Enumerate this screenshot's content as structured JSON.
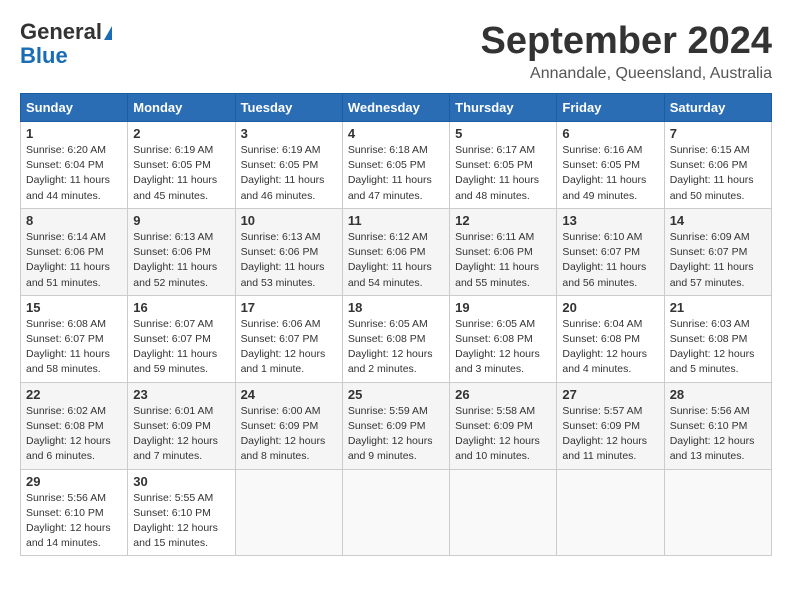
{
  "header": {
    "logo_general": "General",
    "logo_blue": "Blue",
    "month_title": "September 2024",
    "location": "Annandale, Queensland, Australia"
  },
  "calendar": {
    "days_of_week": [
      "Sunday",
      "Monday",
      "Tuesday",
      "Wednesday",
      "Thursday",
      "Friday",
      "Saturday"
    ],
    "weeks": [
      [
        {
          "day": "1",
          "sunrise": "6:20 AM",
          "sunset": "6:04 PM",
          "daylight": "11 hours and 44 minutes."
        },
        {
          "day": "2",
          "sunrise": "6:19 AM",
          "sunset": "6:05 PM",
          "daylight": "11 hours and 45 minutes."
        },
        {
          "day": "3",
          "sunrise": "6:19 AM",
          "sunset": "6:05 PM",
          "daylight": "11 hours and 46 minutes."
        },
        {
          "day": "4",
          "sunrise": "6:18 AM",
          "sunset": "6:05 PM",
          "daylight": "11 hours and 47 minutes."
        },
        {
          "day": "5",
          "sunrise": "6:17 AM",
          "sunset": "6:05 PM",
          "daylight": "11 hours and 48 minutes."
        },
        {
          "day": "6",
          "sunrise": "6:16 AM",
          "sunset": "6:05 PM",
          "daylight": "11 hours and 49 minutes."
        },
        {
          "day": "7",
          "sunrise": "6:15 AM",
          "sunset": "6:06 PM",
          "daylight": "11 hours and 50 minutes."
        }
      ],
      [
        {
          "day": "8",
          "sunrise": "6:14 AM",
          "sunset": "6:06 PM",
          "daylight": "11 hours and 51 minutes."
        },
        {
          "day": "9",
          "sunrise": "6:13 AM",
          "sunset": "6:06 PM",
          "daylight": "11 hours and 52 minutes."
        },
        {
          "day": "10",
          "sunrise": "6:13 AM",
          "sunset": "6:06 PM",
          "daylight": "11 hours and 53 minutes."
        },
        {
          "day": "11",
          "sunrise": "6:12 AM",
          "sunset": "6:06 PM",
          "daylight": "11 hours and 54 minutes."
        },
        {
          "day": "12",
          "sunrise": "6:11 AM",
          "sunset": "6:06 PM",
          "daylight": "11 hours and 55 minutes."
        },
        {
          "day": "13",
          "sunrise": "6:10 AM",
          "sunset": "6:07 PM",
          "daylight": "11 hours and 56 minutes."
        },
        {
          "day": "14",
          "sunrise": "6:09 AM",
          "sunset": "6:07 PM",
          "daylight": "11 hours and 57 minutes."
        }
      ],
      [
        {
          "day": "15",
          "sunrise": "6:08 AM",
          "sunset": "6:07 PM",
          "daylight": "11 hours and 58 minutes."
        },
        {
          "day": "16",
          "sunrise": "6:07 AM",
          "sunset": "6:07 PM",
          "daylight": "11 hours and 59 minutes."
        },
        {
          "day": "17",
          "sunrise": "6:06 AM",
          "sunset": "6:07 PM",
          "daylight": "12 hours and 1 minute."
        },
        {
          "day": "18",
          "sunrise": "6:05 AM",
          "sunset": "6:08 PM",
          "daylight": "12 hours and 2 minutes."
        },
        {
          "day": "19",
          "sunrise": "6:05 AM",
          "sunset": "6:08 PM",
          "daylight": "12 hours and 3 minutes."
        },
        {
          "day": "20",
          "sunrise": "6:04 AM",
          "sunset": "6:08 PM",
          "daylight": "12 hours and 4 minutes."
        },
        {
          "day": "21",
          "sunrise": "6:03 AM",
          "sunset": "6:08 PM",
          "daylight": "12 hours and 5 minutes."
        }
      ],
      [
        {
          "day": "22",
          "sunrise": "6:02 AM",
          "sunset": "6:08 PM",
          "daylight": "12 hours and 6 minutes."
        },
        {
          "day": "23",
          "sunrise": "6:01 AM",
          "sunset": "6:09 PM",
          "daylight": "12 hours and 7 minutes."
        },
        {
          "day": "24",
          "sunrise": "6:00 AM",
          "sunset": "6:09 PM",
          "daylight": "12 hours and 8 minutes."
        },
        {
          "day": "25",
          "sunrise": "5:59 AM",
          "sunset": "6:09 PM",
          "daylight": "12 hours and 9 minutes."
        },
        {
          "day": "26",
          "sunrise": "5:58 AM",
          "sunset": "6:09 PM",
          "daylight": "12 hours and 10 minutes."
        },
        {
          "day": "27",
          "sunrise": "5:57 AM",
          "sunset": "6:09 PM",
          "daylight": "12 hours and 11 minutes."
        },
        {
          "day": "28",
          "sunrise": "5:56 AM",
          "sunset": "6:10 PM",
          "daylight": "12 hours and 13 minutes."
        }
      ],
      [
        {
          "day": "29",
          "sunrise": "5:56 AM",
          "sunset": "6:10 PM",
          "daylight": "12 hours and 14 minutes."
        },
        {
          "day": "30",
          "sunrise": "5:55 AM",
          "sunset": "6:10 PM",
          "daylight": "12 hours and 15 minutes."
        },
        null,
        null,
        null,
        null,
        null
      ]
    ]
  }
}
